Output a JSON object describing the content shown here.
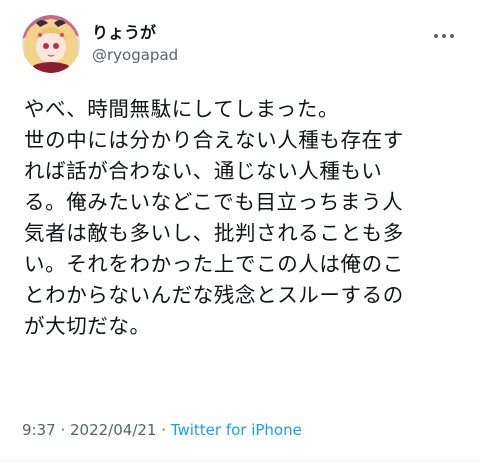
{
  "author": {
    "display_name": "りょうが",
    "handle": "@ryogapad"
  },
  "tweet": {
    "text_lines": [
      "やべ、時間無駄にしてしまった。",
      "世の中には分かり合えない人種も存在す",
      "れば話が合わない、通じない人種もい",
      "る。俺みたいなどこでも目立っちまう人",
      "気者は敵も多いし、批判されることも多",
      "い。それをわかった上でこの人は俺のこ",
      "とわからないんだな残念とスルーするの",
      "が大切だな。"
    ]
  },
  "meta": {
    "time": "9:37",
    "separator": " · ",
    "date": "2022/04/21",
    "separator2": " · ",
    "source": "Twitter for iPhone"
  },
  "colors": {
    "text": "#0f1419",
    "muted": "#536471",
    "accent": "#1d9bf0"
  }
}
